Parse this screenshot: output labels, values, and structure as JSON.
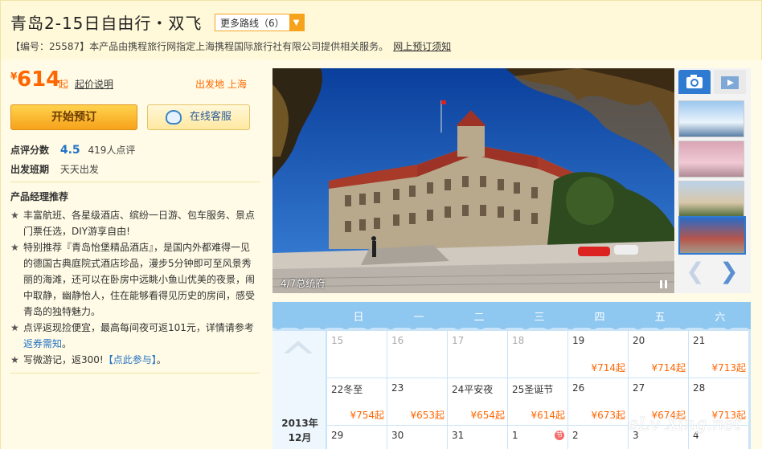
{
  "header": {
    "title": "青岛2-15日自由行・双飞",
    "more_routes_label": "更多路线（6）",
    "subtitle": "【编号：25587】本产品由携程旅行网指定上海携程国际旅行社有限公司提供相关服务。",
    "booking_notice_link": "网上预订须知"
  },
  "pricing": {
    "currency": "¥",
    "price": "614",
    "suffix": "起",
    "price_note_link": "起价说明",
    "departure_label": "出发地",
    "departure_city": "上海"
  },
  "actions": {
    "book_label": "开始预订",
    "service_label": "在线客服"
  },
  "info": {
    "rating_label": "点评分数",
    "rating_value": "4.5",
    "rating_count": "419人点评",
    "schedule_label": "出发班期",
    "schedule_value": "天天出发"
  },
  "manager": {
    "title": "产品经理推荐",
    "items": [
      {
        "text": "丰富航班、各星级酒店、缤纷一日游、包车服务、景点门票任选，DIY游享自由!"
      },
      {
        "text": "特别推荐『青岛怡堡精品酒店』，是国内外都难得一见的德国古典庭院式酒店珍品，漫步5分钟即可至风景秀丽的海滩，还可以在卧房中远眺小鱼山优美的夜景，闹中取静，幽静怡人，住在能够看得见历史的房间，感受青岛的独特魅力。"
      },
      {
        "text_a": "点评返现捡便宜，最高每间夜可返101元，详情请参考",
        "link": "返券需知",
        "text_b": "。"
      },
      {
        "text_a": "写微游记，返300!",
        "link": "【点此参与】",
        "text_b": "。"
      }
    ]
  },
  "gallery": {
    "caption": "4/7总统府",
    "prev": "❮",
    "next": "❯"
  },
  "calendar": {
    "year_month_year": "2013年",
    "year_month_month": "12月",
    "weekdays": [
      "日",
      "一",
      "二",
      "三",
      "四",
      "五",
      "六"
    ],
    "rows": [
      [
        {
          "day": "15",
          "past": true,
          "price": ""
        },
        {
          "day": "16",
          "past": true,
          "price": ""
        },
        {
          "day": "17",
          "past": true,
          "price": ""
        },
        {
          "day": "18",
          "past": true,
          "price": ""
        },
        {
          "day": "19",
          "past": false,
          "price": "¥714起"
        },
        {
          "day": "20",
          "past": false,
          "price": "¥714起"
        },
        {
          "day": "21",
          "past": false,
          "price": "¥713起"
        }
      ],
      [
        {
          "day": "22冬至",
          "past": false,
          "price": "¥754起"
        },
        {
          "day": "23",
          "past": false,
          "price": "¥653起"
        },
        {
          "day": "24平安夜",
          "past": false,
          "price": "¥654起"
        },
        {
          "day": "25圣诞节",
          "past": false,
          "price": "¥614起"
        },
        {
          "day": "26",
          "past": false,
          "price": "¥673起"
        },
        {
          "day": "27",
          "past": false,
          "price": "¥674起"
        },
        {
          "day": "28",
          "past": false,
          "price": "¥713起"
        }
      ],
      [
        {
          "day": "29",
          "past": false,
          "price": ""
        },
        {
          "day": "30",
          "past": false,
          "price": ""
        },
        {
          "day": "31",
          "past": false,
          "price": ""
        },
        {
          "day": "1",
          "past": false,
          "price": "",
          "holiday": "节"
        },
        {
          "day": "2",
          "past": false,
          "price": ""
        },
        {
          "day": "3",
          "past": false,
          "price": ""
        },
        {
          "day": "4",
          "past": false,
          "price": ""
        }
      ]
    ]
  },
  "watermark": "eLv Xing.net"
}
